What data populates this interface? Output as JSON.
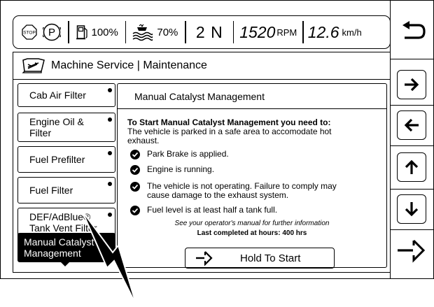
{
  "status_bar": {
    "stop_icon_label": "STOP",
    "park_icon_label": "P",
    "fuel_level": "100%",
    "def_level": "70%",
    "gear": "2 N",
    "rpm_value": "1520",
    "rpm_unit": "RPM",
    "speed_value": "12.6",
    "speed_unit": "km/h"
  },
  "header": {
    "title": "Machine Service | Maintenance",
    "icon": "service-book-icon"
  },
  "side_buttons": [
    {
      "icon": "back-icon"
    },
    {
      "icon": "arrow-right-icon"
    },
    {
      "icon": "arrow-left-icon"
    },
    {
      "icon": "arrow-up-icon"
    },
    {
      "icon": "arrow-down-icon"
    },
    {
      "icon": "enter-icon"
    }
  ],
  "list": {
    "items": [
      {
        "label": "Cab Air Filter",
        "dot": true,
        "selected": false
      },
      {
        "label": "Engine Oil & Filter",
        "dot": true,
        "selected": false
      },
      {
        "label": "Fuel Prefilter",
        "dot": true,
        "selected": false
      },
      {
        "label": "Fuel Filter",
        "dot": true,
        "selected": false
      },
      {
        "label": "DEF/AdBlue® Tank Vent Filter",
        "dot": true,
        "selected": false
      },
      {
        "label": "Manual Catalyst Management",
        "dot": false,
        "selected": true
      }
    ]
  },
  "content": {
    "title": "Manual Catalyst Management",
    "heading": "To Start Manual Catalyst Management you need to:",
    "intro": "The vehicle is parked in a safe area to accomodate hot exhaust.",
    "checks": [
      "Park Brake is applied.",
      "Engine is running.",
      "The vehicle is not operating. Failure to comply may cause damage to the exhaust system.",
      "Fuel level is at least half a tank full."
    ],
    "note": "See your operator's manual for further information",
    "last_completed": "Last completed at hours: 400 hrs",
    "hold_button": "Hold To Start"
  }
}
